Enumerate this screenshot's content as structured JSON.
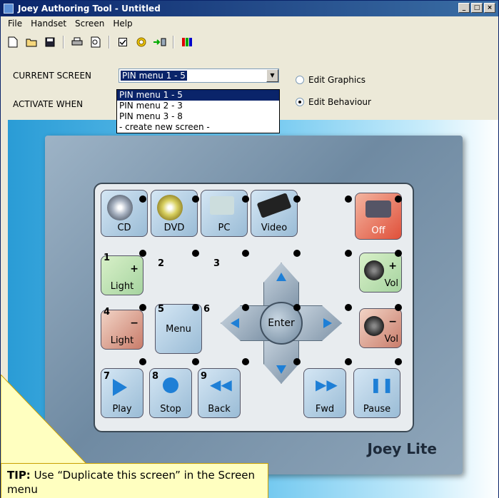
{
  "window": {
    "title": "Joey Authoring Tool - Untitled",
    "controls": [
      "_",
      "□",
      "×"
    ]
  },
  "menu": [
    "File",
    "Handset",
    "Screen",
    "Help"
  ],
  "toolbar": {
    "icons": [
      "new-icon",
      "open-icon",
      "save-icon",
      "print-icon",
      "print-preview-icon",
      "checkbox-icon",
      "target-icon",
      "export-icon",
      "color-bars-icon"
    ]
  },
  "current_screen": {
    "label": "CURRENT SCREEN",
    "value": "PIN menu 1 - 5"
  },
  "activate_when": {
    "label": "ACTIVATE WHEN"
  },
  "dropdown": {
    "options": [
      "PIN menu 1 - 5",
      "PIN menu 2 - 3",
      "PIN menu 3 - 8",
      "- create new screen -"
    ],
    "selected_index": 0
  },
  "mode": {
    "edit_graphics": "Edit Graphics",
    "edit_behaviour": "Edit Behaviour",
    "selected": "Edit Behaviour"
  },
  "remote": {
    "brand": "Joey Lite",
    "top_keys": [
      "CD",
      "DVD",
      "PC",
      "Video"
    ],
    "off_key": "Off",
    "light_up": {
      "pin": "1",
      "symbol": "+",
      "label": "Light"
    },
    "light_down": {
      "pin": "4",
      "symbol": "−",
      "label": "Light"
    },
    "pin_labels": [
      "2",
      "3",
      "6"
    ],
    "menu_key": {
      "pin": "5",
      "label": "Menu"
    },
    "vol_up": {
      "symbol": "+",
      "label": "Vol"
    },
    "vol_down": {
      "symbol": "−",
      "label": "Vol"
    },
    "enter": "Enter",
    "bottom_keys": [
      {
        "pin": "7",
        "label": "Play"
      },
      {
        "pin": "8",
        "label": "Stop"
      },
      {
        "pin": "9",
        "label": "Back"
      },
      {
        "pin": "",
        "label": "Fwd"
      },
      {
        "pin": "",
        "label": "Pause"
      }
    ]
  },
  "tip": {
    "bold": "TIP:",
    "text": " Use “Duplicate this screen” in the Screen menu"
  }
}
